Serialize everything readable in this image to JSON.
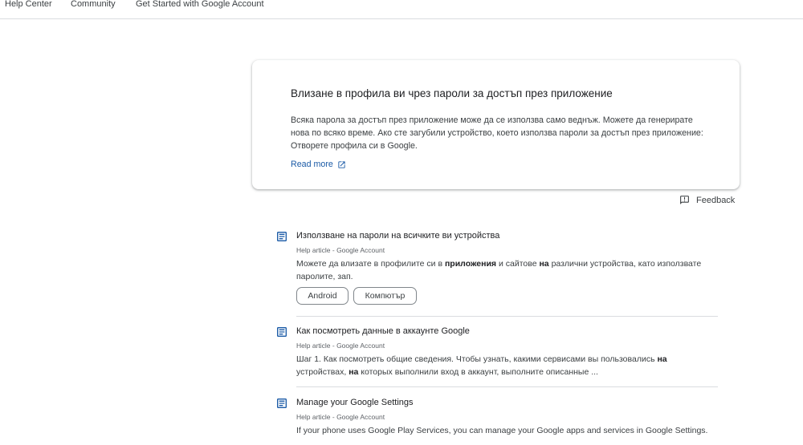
{
  "nav": {
    "help_center": "Help Center",
    "community": "Community",
    "get_started": "Get Started with Google Account"
  },
  "card": {
    "title": "Влизане в профила ви чрез пароли за достъп през приложение",
    "body": "Всяка парола за достъп през приложение може да се използва само веднъж. Можете да генерирате нова по всяко време. Ако сте загубили устройство, което използва пароли за достъп през приложение: Отворете профила си в Google.",
    "read_more": "Read more"
  },
  "feedback": {
    "label": "Feedback"
  },
  "results": [
    {
      "title": "Използване на пароли на всичките ви устройства",
      "source": "Help article - Google Account",
      "snippet_parts": [
        "Можете да влизате в профилите си в ",
        "приложения",
        " и сайтове ",
        "на",
        " различни устройства, като използвате паролите, зап."
      ],
      "chips": [
        "Android",
        "Компютър"
      ]
    },
    {
      "title": "Как посмотреть данные в аккаунте Google",
      "source": "Help article - Google Account",
      "snippet_parts": [
        "Шаг 1. Как посмотреть общие сведения. Чтобы узнать, какими сервисами вы пользовались ",
        "на",
        " устройствах, ",
        "на",
        " которых выполнили вход в аккаунт, выполните описанные ..."
      ]
    },
    {
      "title": "Manage your Google Settings",
      "source": "Help article - Google Account",
      "snippet_parts": [
        "If your phone uses Google Play Services, you can manage your Google apps and services in Google Settings."
      ]
    }
  ],
  "colors": {
    "link": "#1a5aa6",
    "doc_icon": "#1a5aa6",
    "divider": "#dadce0"
  },
  "icons": {
    "result": "article-icon",
    "read_more": "open-in-new-icon",
    "feedback": "feedback-icon"
  }
}
